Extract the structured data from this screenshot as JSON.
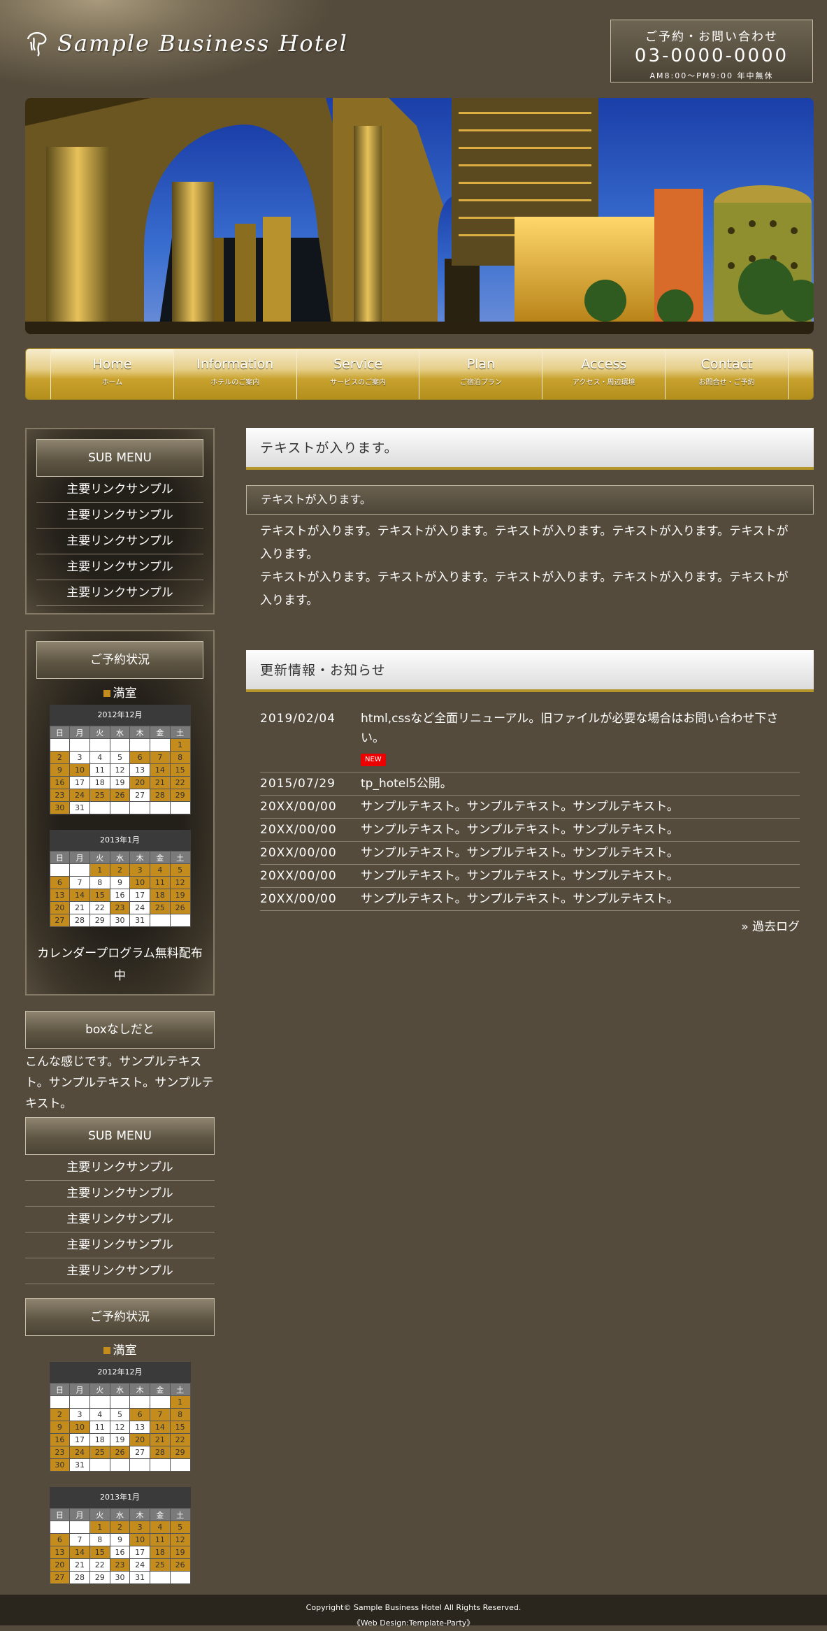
{
  "header": {
    "logo_text": "Sample Business Hotel",
    "contact_label": "ご予約・お問い合わせ",
    "phone": "03-0000-0000",
    "hours": "AM8:00～PM9:00 年中無休"
  },
  "nav": [
    {
      "en": "Home",
      "ja": "ホーム"
    },
    {
      "en": "Information",
      "ja": "ホテルのご案内"
    },
    {
      "en": "Service",
      "ja": "サービスのご案内"
    },
    {
      "en": "Plan",
      "ja": "ご宿泊プラン"
    },
    {
      "en": "Access",
      "ja": "アクセス・周辺環境"
    },
    {
      "en": "Contact",
      "ja": "お問合せ・ご予約"
    }
  ],
  "sidebar": {
    "submenu_title": "SUB MENU",
    "submenu_items": [
      "主要リンクサンプル",
      "主要リンクサンプル",
      "主要リンクサンプル",
      "主要リンクサンプル",
      "主要リンクサンプル"
    ],
    "reserve_title": "ご予約状況",
    "status_label": "満室",
    "calendar_link": "カレンダープログラム無料配布中",
    "boxless_title": "boxなしだと",
    "boxless_text": "こんな感じです。サンプルテキスト。サンプルテキスト。サンプルテキスト。",
    "calendars": [
      {
        "caption": "2012年12月",
        "weekdays": [
          "日",
          "月",
          "火",
          "水",
          "木",
          "金",
          "土"
        ],
        "rows": [
          [
            "",
            "",
            "",
            "",
            "",
            "",
            "1"
          ],
          [
            "2",
            "3",
            "4",
            "5",
            "6",
            "7",
            "8"
          ],
          [
            "9",
            "10",
            "11",
            "12",
            "13",
            "14",
            "15"
          ],
          [
            "16",
            "17",
            "18",
            "19",
            "20",
            "21",
            "22"
          ],
          [
            "23",
            "24",
            "25",
            "26",
            "27",
            "28",
            "29"
          ],
          [
            "30",
            "31",
            "",
            "",
            "",
            "",
            ""
          ]
        ],
        "holidays": [
          "1",
          "2",
          "6",
          "7",
          "8",
          "9",
          "10",
          "14",
          "15",
          "16",
          "20",
          "21",
          "22",
          "23",
          "24",
          "25",
          "26",
          "28",
          "29",
          "30"
        ]
      },
      {
        "caption": "2013年1月",
        "weekdays": [
          "日",
          "月",
          "火",
          "水",
          "木",
          "金",
          "土"
        ],
        "rows": [
          [
            "",
            "",
            "1",
            "2",
            "3",
            "4",
            "5"
          ],
          [
            "6",
            "7",
            "8",
            "9",
            "10",
            "11",
            "12"
          ],
          [
            "13",
            "14",
            "15",
            "16",
            "17",
            "18",
            "19"
          ],
          [
            "20",
            "21",
            "22",
            "23",
            "24",
            "25",
            "26"
          ],
          [
            "27",
            "28",
            "29",
            "30",
            "31",
            "",
            ""
          ]
        ],
        "holidays": [
          "1",
          "2",
          "3",
          "4",
          "5",
          "6",
          "10",
          "11",
          "12",
          "13",
          "14",
          "15",
          "18",
          "19",
          "20",
          "23",
          "25",
          "26",
          "27"
        ]
      }
    ]
  },
  "main": {
    "title1": "テキストが入ります。",
    "sub1": "テキストが入ります。",
    "para1": "テキストが入ります。テキストが入ります。テキストが入ります。テキストが入ります。テキストが入ります。",
    "para2": "テキストが入ります。テキストが入ります。テキストが入ります。テキストが入ります。テキストが入ります。",
    "news_title": "更新情報・お知らせ",
    "new_badge": "NEW",
    "news": [
      {
        "date": "2019/02/04",
        "text": "html,cssなど全面リニューアル。旧ファイルが必要な場合はお問い合わせ下さい。"
      },
      {
        "date": "2015/07/29",
        "text": "tp_hotel5公開。"
      },
      {
        "date": "20XX/00/00",
        "text": "サンプルテキスト。サンプルテキスト。サンプルテキスト。"
      },
      {
        "date": "20XX/00/00",
        "text": "サンプルテキスト。サンプルテキスト。サンプルテキスト。"
      },
      {
        "date": "20XX/00/00",
        "text": "サンプルテキスト。サンプルテキスト。サンプルテキスト。"
      },
      {
        "date": "20XX/00/00",
        "text": "サンプルテキスト。サンプルテキスト。サンプルテキスト。"
      },
      {
        "date": "20XX/00/00",
        "text": "サンプルテキスト。サンプルテキスト。サンプルテキスト。"
      }
    ],
    "more_prefix": "»",
    "more_link": "過去ログ"
  },
  "footer": {
    "copyright": "Copyright© Sample Business Hotel All Rights Reserved.",
    "design": "《Web Design:Template-Party》"
  },
  "colors": {
    "background": "#544b3c",
    "accent_gold": "#c48b1d",
    "nav_gold": "#c9a22e",
    "new_badge": "#ee0000"
  }
}
